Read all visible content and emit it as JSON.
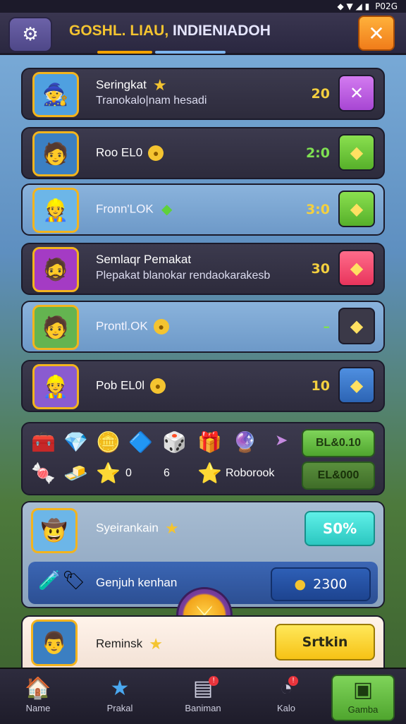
{
  "status": {
    "time": "P02G"
  },
  "header": {
    "title_part1": "GOSHL. LIAU,",
    "title_part2": "INDIENIADOH",
    "gear_icon": "gear-icon",
    "close_icon": "close-icon"
  },
  "rows": [
    {
      "name": "Seringkat",
      "sub": "Tranokalo|nam hesadi",
      "value": "20",
      "action": "✕",
      "name_icon": "★"
    },
    {
      "name": "Roo EL0",
      "sub": "",
      "value": "2:0",
      "action": "◆",
      "name_icon": "●"
    },
    {
      "name": "Fronn'LOK",
      "sub": "",
      "value": "3:0",
      "action": "◆",
      "name_icon": "◆"
    },
    {
      "name": "Semlaqr Pemakat",
      "sub": "Plepakat blanokar rendaokarakesb",
      "value": "30",
      "action": "◆",
      "name_icon": ""
    },
    {
      "name": "Prontl.OK",
      "sub": "",
      "value": "–",
      "action": "◆",
      "name_icon": "●"
    },
    {
      "name": "Pob EL0l",
      "sub": "",
      "value": "10",
      "action": "◆",
      "name_icon": "●"
    }
  ],
  "inventory": {
    "count_a": "0",
    "count_b": "6",
    "label": "Roborook",
    "btn1": "BL&0.10",
    "btn2": "EL&000"
  },
  "card": {
    "name": "Syeirankain",
    "pct": "S0%",
    "strip_label": "Genjuh kenhan",
    "coin_value": "2300"
  },
  "bottom": {
    "name": "Reminsk",
    "btn": "Srtkin"
  },
  "nav": [
    {
      "label": "Name",
      "icon": "home-icon"
    },
    {
      "label": "Prakal",
      "icon": "star-icon"
    },
    {
      "label": "Baniman",
      "icon": "list-icon"
    },
    {
      "label": "Kalo",
      "icon": "timer-icon"
    },
    {
      "label": "Gamba",
      "icon": "cube-icon"
    }
  ]
}
